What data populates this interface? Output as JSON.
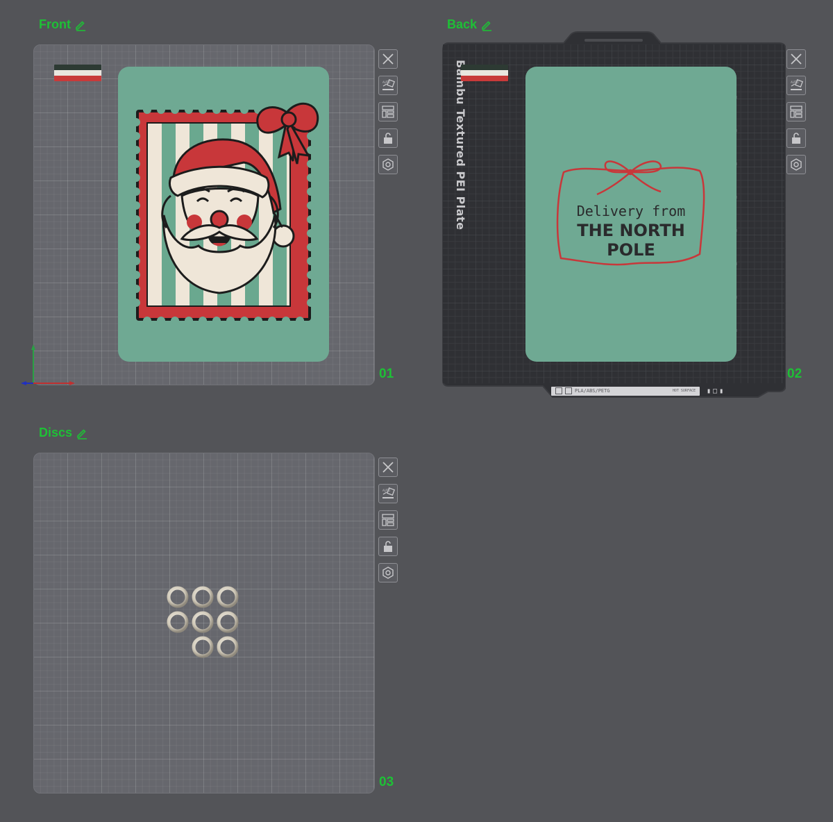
{
  "plates": [
    {
      "id": "front",
      "name": "Front",
      "number": "01"
    },
    {
      "id": "back",
      "name": "Back",
      "number": "02"
    },
    {
      "id": "discs",
      "name": "Discs",
      "number": "03"
    }
  ],
  "toolbar": [
    "close-icon",
    "auto-orient-icon",
    "arrange-icon",
    "lock-icon",
    "settings-icon"
  ],
  "back_plate": {
    "label": "Bambu Textured PEI Plate",
    "footer": {
      "material": "PLA/ABS/PETG",
      "surface": "HOT SURFACE"
    }
  },
  "back_card": {
    "line1": "Delivery from",
    "line2": "THE NORTH POLE"
  },
  "filament_colors": [
    "#2d3a33",
    "#e9e6df",
    "#c83a3a"
  ],
  "colors": {
    "accent": "#1ec036",
    "card": "#6fa993",
    "santa_red": "#c8373a",
    "cream": "#efe6d8",
    "stripe_green": "#6aa88f",
    "outline": "#1c1c1c"
  }
}
